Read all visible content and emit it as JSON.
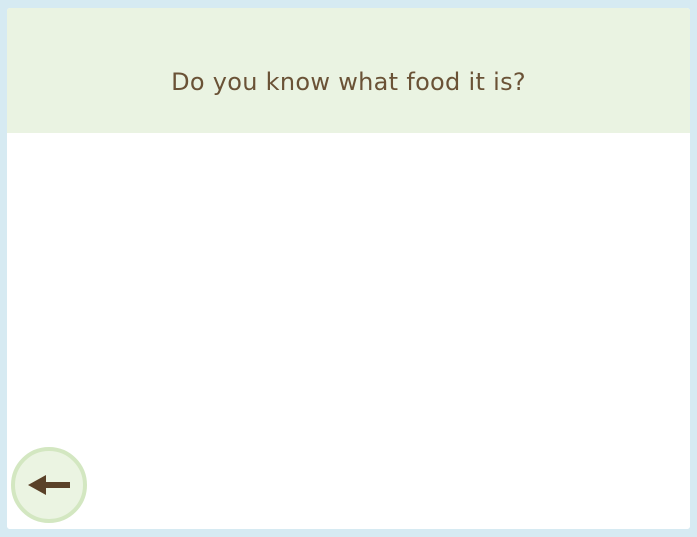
{
  "header": {
    "question": "Do you know what food it is?"
  },
  "navigation": {
    "back_icon": "arrow-left-icon"
  },
  "colors": {
    "page_background": "#d6eaf2",
    "header_background": "#eaf3e2",
    "text": "#6a5236",
    "button_ring": "#d3e7c1",
    "button_fill": "#ebf4e2",
    "arrow": "#5a4128"
  }
}
